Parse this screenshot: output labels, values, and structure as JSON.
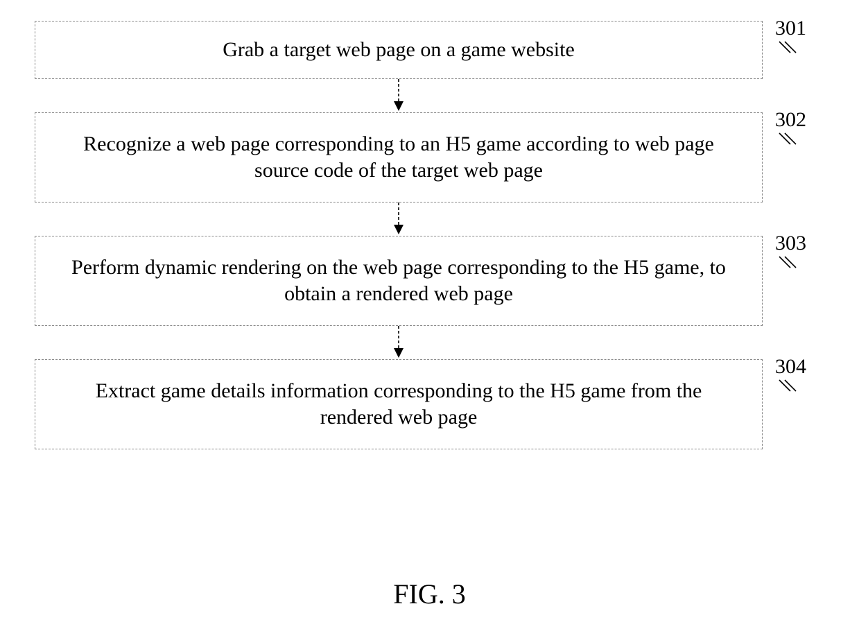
{
  "flowchart": {
    "steps": [
      {
        "label": "301",
        "text": "Grab a target web page on a game website"
      },
      {
        "label": "302",
        "text": "Recognize a web page corresponding to an H5 game according to web page source code of the target web page"
      },
      {
        "label": "303",
        "text": "Perform dynamic rendering on the web page corresponding to the H5 game, to obtain a rendered web page"
      },
      {
        "label": "304",
        "text": "Extract game details information corresponding to the H5 game from the rendered web page"
      }
    ],
    "caption": "FIG. 3"
  }
}
